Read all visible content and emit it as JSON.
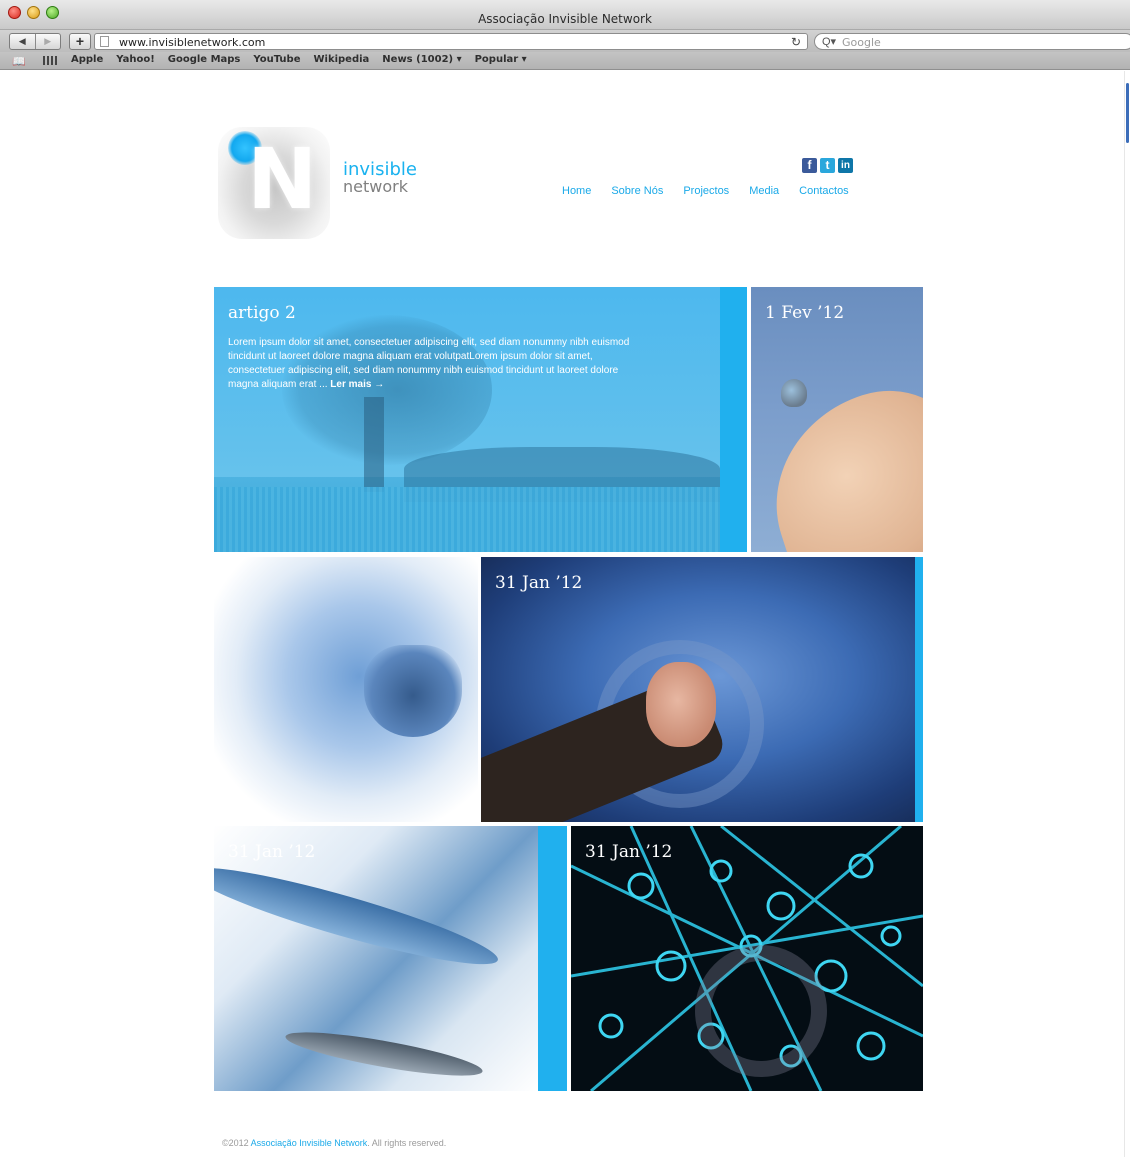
{
  "browser": {
    "window_title": "Associação Invisible Network",
    "url": "www.invisiblenetwork.com",
    "search_placeholder": "Google",
    "bookmarks": [
      "Apple",
      "Yahoo!",
      "Google Maps",
      "YouTube",
      "Wikipedia",
      "News (1002) ▾",
      "Popular ▾"
    ]
  },
  "site": {
    "logo_line1": "invisible",
    "logo_line2": "network",
    "logo_letter": "N",
    "social": [
      "f",
      "t",
      "in"
    ],
    "nav": [
      "Home",
      "Sobre Nós",
      "Projectos",
      "Media",
      "Contactos"
    ]
  },
  "tiles": {
    "featured_title": "artigo 2",
    "featured_body": "Lorem ipsum dolor sit amet, consectetuer adipiscing elit, sed diam nonummy nibh euismod tincidunt ut laoreet dolore magna aliquam erat volutpatLorem ipsum dolor sit amet, consectetuer adipiscing elit, sed diam nonummy nibh euismod tincidunt ut laoreet dolore magna aliquam erat ...",
    "featured_more": "Ler mais →",
    "date_1": "1 Fev ’12",
    "date_2": "31 Jan ’12",
    "date_3": "31 Jan ’12",
    "date_4": "31 Jan ’12"
  },
  "footer": {
    "prefix": "©2012 ",
    "link": "Associação Invisible Network",
    "suffix": ". All rights reserved."
  },
  "colors": {
    "accent": "#20b0ee",
    "nav_link": "#1aa9e8"
  }
}
